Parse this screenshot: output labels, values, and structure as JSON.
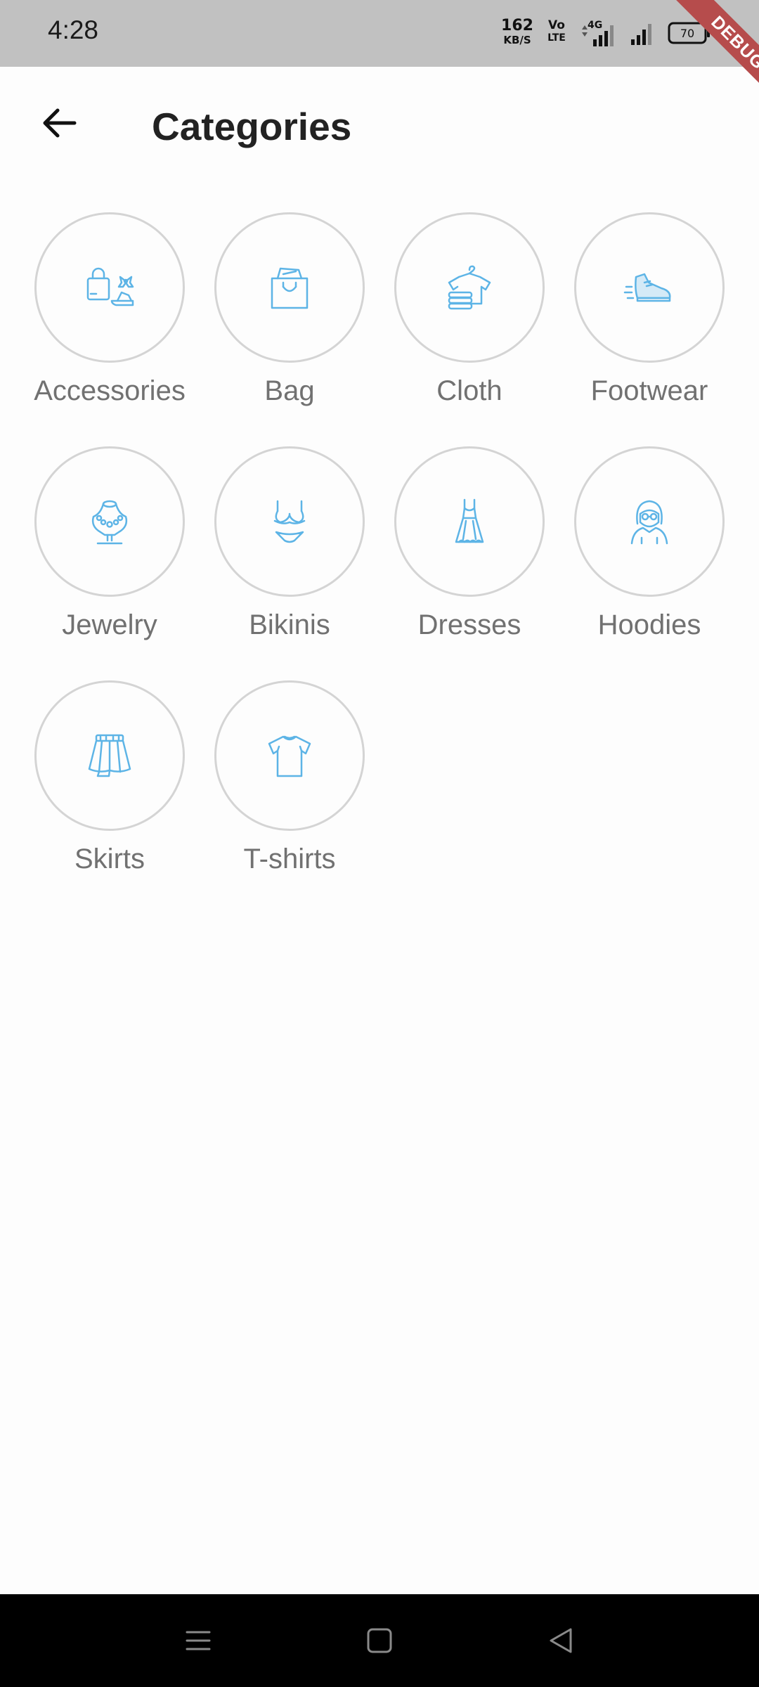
{
  "status_bar": {
    "time": "4:28",
    "net_speed_value": "162",
    "net_speed_unit": "KB/S",
    "volte_top": "Vo",
    "volte_bottom": "LTE",
    "network_type": "4G",
    "battery_level": "70"
  },
  "debug_banner": {
    "label": "DEBUG",
    "color": "#b64c4c"
  },
  "header": {
    "title": "Categories",
    "back_icon": "arrow-left-icon"
  },
  "accent_color": "#5db4e6",
  "categories": [
    {
      "label": "Accessories",
      "icon": "accessories-icon"
    },
    {
      "label": "Bag",
      "icon": "shopping-bag-icon"
    },
    {
      "label": "Cloth",
      "icon": "clothing-stack-icon"
    },
    {
      "label": "Footwear",
      "icon": "sneaker-icon"
    },
    {
      "label": "Jewelry",
      "icon": "necklace-icon"
    },
    {
      "label": "Bikinis",
      "icon": "bikini-icon"
    },
    {
      "label": "Dresses",
      "icon": "dress-icon"
    },
    {
      "label": "Hoodies",
      "icon": "hoodie-person-icon"
    },
    {
      "label": "Skirts",
      "icon": "skirt-icon"
    },
    {
      "label": "T-shirts",
      "icon": "tshirt-icon"
    }
  ],
  "nav_bar": {
    "menu_icon": "menu-icon",
    "home_icon": "home-square-icon",
    "back_icon": "back-triangle-icon"
  }
}
